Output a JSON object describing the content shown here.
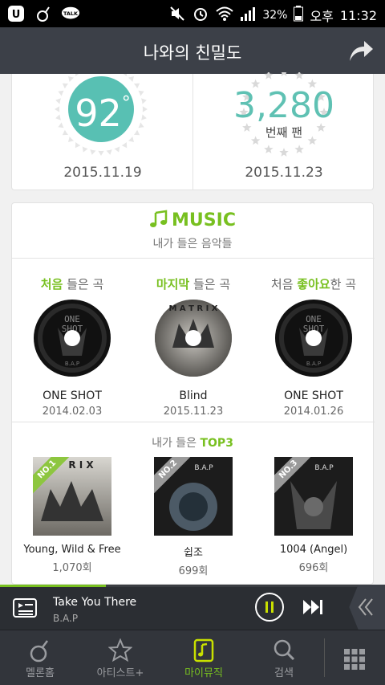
{
  "statusbar": {
    "carrier_icon": "U-plus-icon",
    "melon_icon": "melon-icon",
    "talk_label": "TALK",
    "battery": "32%",
    "ampm": "오후",
    "time": "11:32"
  },
  "header": {
    "title": "나와의 친밀도",
    "share_icon": "share-arrow-icon"
  },
  "stats": {
    "affinity_value": "92",
    "affinity_unit": "°",
    "affinity_date": "2015.11.19",
    "fan_number": "3,280",
    "fan_label": "번째 팬",
    "fan_date": "2015.11.23"
  },
  "music": {
    "title": "MUSIC",
    "subtitle": "내가 들은 음악들",
    "columns": [
      {
        "head_prefix": "",
        "head_highlight": "처음",
        "head_suffix": " 들은 곡",
        "title": "ONE SHOT",
        "date": "2014.02.03"
      },
      {
        "head_prefix": "",
        "head_highlight": "마지막",
        "head_suffix": " 들은 곡",
        "title": "Blind",
        "date": "2015.11.23"
      },
      {
        "head_prefix": "처음 ",
        "head_highlight": "좋아요",
        "head_suffix": "한 곡",
        "title": "ONE SHOT",
        "date": "2014.01.26"
      }
    ],
    "top3_prefix": "내가 들은 ",
    "top3_highlight": "TOP3",
    "top3": [
      {
        "rank": "NO.1",
        "title": "Young, Wild & Free",
        "count": "1,070회",
        "ribbon_color": "#8dc63f"
      },
      {
        "rank": "NO.2",
        "title": "쉽조",
        "count": "699회",
        "ribbon_color": "#9a9a9a"
      },
      {
        "rank": "NO.3",
        "title": "1004 (Angel)",
        "count": "696회",
        "ribbon_color": "#9a9a9a"
      }
    ]
  },
  "player": {
    "song_title": "Take You There",
    "artist": "B.A.P",
    "progress": 0.275
  },
  "nav": {
    "items": [
      {
        "label": "멜론홈",
        "icon": "melon-home-icon"
      },
      {
        "label": "아티스트+",
        "icon": "star-icon"
      },
      {
        "label": "마이뮤직",
        "icon": "my-music-icon"
      },
      {
        "label": "검색",
        "icon": "search-icon"
      }
    ],
    "more_icon": "grid-menu-icon"
  },
  "colors": {
    "accent": "#78c020",
    "teal": "#58c0b3",
    "header_bg": "#3c4048"
  }
}
